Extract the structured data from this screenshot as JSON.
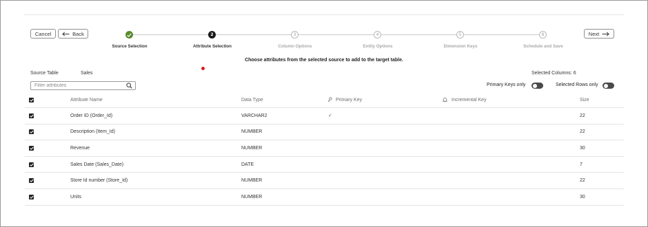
{
  "nav": {
    "cancel_label": "Cancel",
    "back_label": "Back",
    "next_label": "Next"
  },
  "steps": [
    {
      "number": "1",
      "label": "Source Selection",
      "state": "done"
    },
    {
      "number": "2",
      "label": "Attribute Selection",
      "state": "current"
    },
    {
      "number": "3",
      "label": "Column Options",
      "state": "future"
    },
    {
      "number": "4",
      "label": "Entity Options",
      "state": "future"
    },
    {
      "number": "5",
      "label": "Dimension Keys",
      "state": "future"
    },
    {
      "number": "6",
      "label": "Schedule and Save",
      "state": "future"
    }
  ],
  "instruction": "Choose attributes from the selected source to add to the target table.",
  "source": {
    "label": "Source Table",
    "value": "Sales"
  },
  "selected": {
    "label": "Selected Columns:",
    "count": "6"
  },
  "filter": {
    "placeholder": "Filter attributes",
    "value": ""
  },
  "toggles": {
    "primary_keys_label": "Primary Keys only",
    "selected_rows_label": "Selected Rows only"
  },
  "table": {
    "headers": {
      "attribute_name": "Attribute Name",
      "data_type": "Data Type",
      "primary_key": "Primary Key",
      "incremental_key": "Incremental Key",
      "size": "Size"
    },
    "rows": [
      {
        "name": "Order ID (Order_Id)",
        "type": "VARCHAR2",
        "pk": "✓",
        "size": "22"
      },
      {
        "name": "Description (Item_Id)",
        "type": "NUMBER",
        "pk": "",
        "size": "22"
      },
      {
        "name": "Revenue",
        "type": "NUMBER",
        "pk": "",
        "size": "30"
      },
      {
        "name": "Sales Date (Sales_Date)",
        "type": "DATE",
        "pk": "",
        "size": "7"
      },
      {
        "name": "Store Id number (Store_Id)",
        "type": "NUMBER",
        "pk": "",
        "size": "22"
      },
      {
        "name": "Units",
        "type": "NUMBER",
        "pk": "",
        "size": "30"
      }
    ]
  },
  "colors": {
    "done": "#5a8a2e",
    "current": "#1a1a1a",
    "alert": "#d42020"
  }
}
